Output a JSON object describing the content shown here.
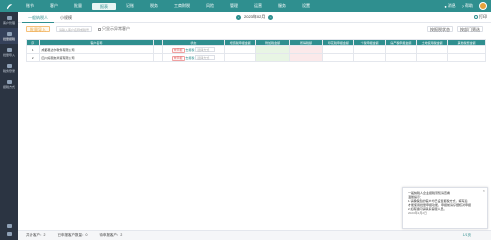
{
  "nav": {
    "items": [
      "账节",
      "客户",
      "批量",
      "报表",
      "记账",
      "税务",
      "工商财税",
      "风险",
      "管理",
      "运营",
      "服务",
      "设置"
    ],
    "active_index": 3,
    "right_items": [
      "消息",
      "帮助"
    ]
  },
  "sidebar": {
    "items": [
      "客户管理",
      "批量报税",
      "批量导入",
      "税务登录",
      "报税方式"
    ],
    "active_index": 1
  },
  "tabs": [
    "一般纳税人",
    "小规模"
  ],
  "period": {
    "label": "2023年02月"
  },
  "print_label": "打印",
  "toolbar": {
    "batch_label": "批量导入",
    "search_placeholder": "请输入客户名称或税号",
    "checkbox_label": "只显示异常客户",
    "select1": "按报税状态",
    "select2": "按部门筛选"
  },
  "table": {
    "headers": [
      "序",
      "客户名称",
      "",
      "状态",
      "增值税申报金额",
      "附加税金额",
      "所得税额",
      "印花税申报金额",
      "个税申报金额",
      "房产税申报金额",
      "土地使用税金额",
      "其他税费金额"
    ],
    "rows": [
      {
        "index": "1",
        "name": "成都易达尔软件有限公司",
        "tag": "未申报",
        "link": "去报税",
        "select": "选择方式"
      },
      {
        "index": "2",
        "name": "四川好朋友商贸有限公司",
        "tag": "未申报",
        "link": "去报税",
        "select": "选择方式"
      }
    ]
  },
  "footer": {
    "total_label": "共计客户：2",
    "declared_label": "已申报客户数量：0",
    "pending_label": "待申报客户：2",
    "pager": "1/1页"
  },
  "notice": {
    "lines": [
      "一般纳税人企业报税须知请查看",
      "温馨提示：",
      "1.请确保您的客户均已设置报税方式，填写后",
      "才能使用批量申报功能，申报前请仔细核对申报",
      "2.如有疑问请联系客服人员。"
    ],
    "date": "2023年2月2日"
  },
  "colors": {
    "primary": "#2f8f8f",
    "sidebar": "#2b3442"
  }
}
